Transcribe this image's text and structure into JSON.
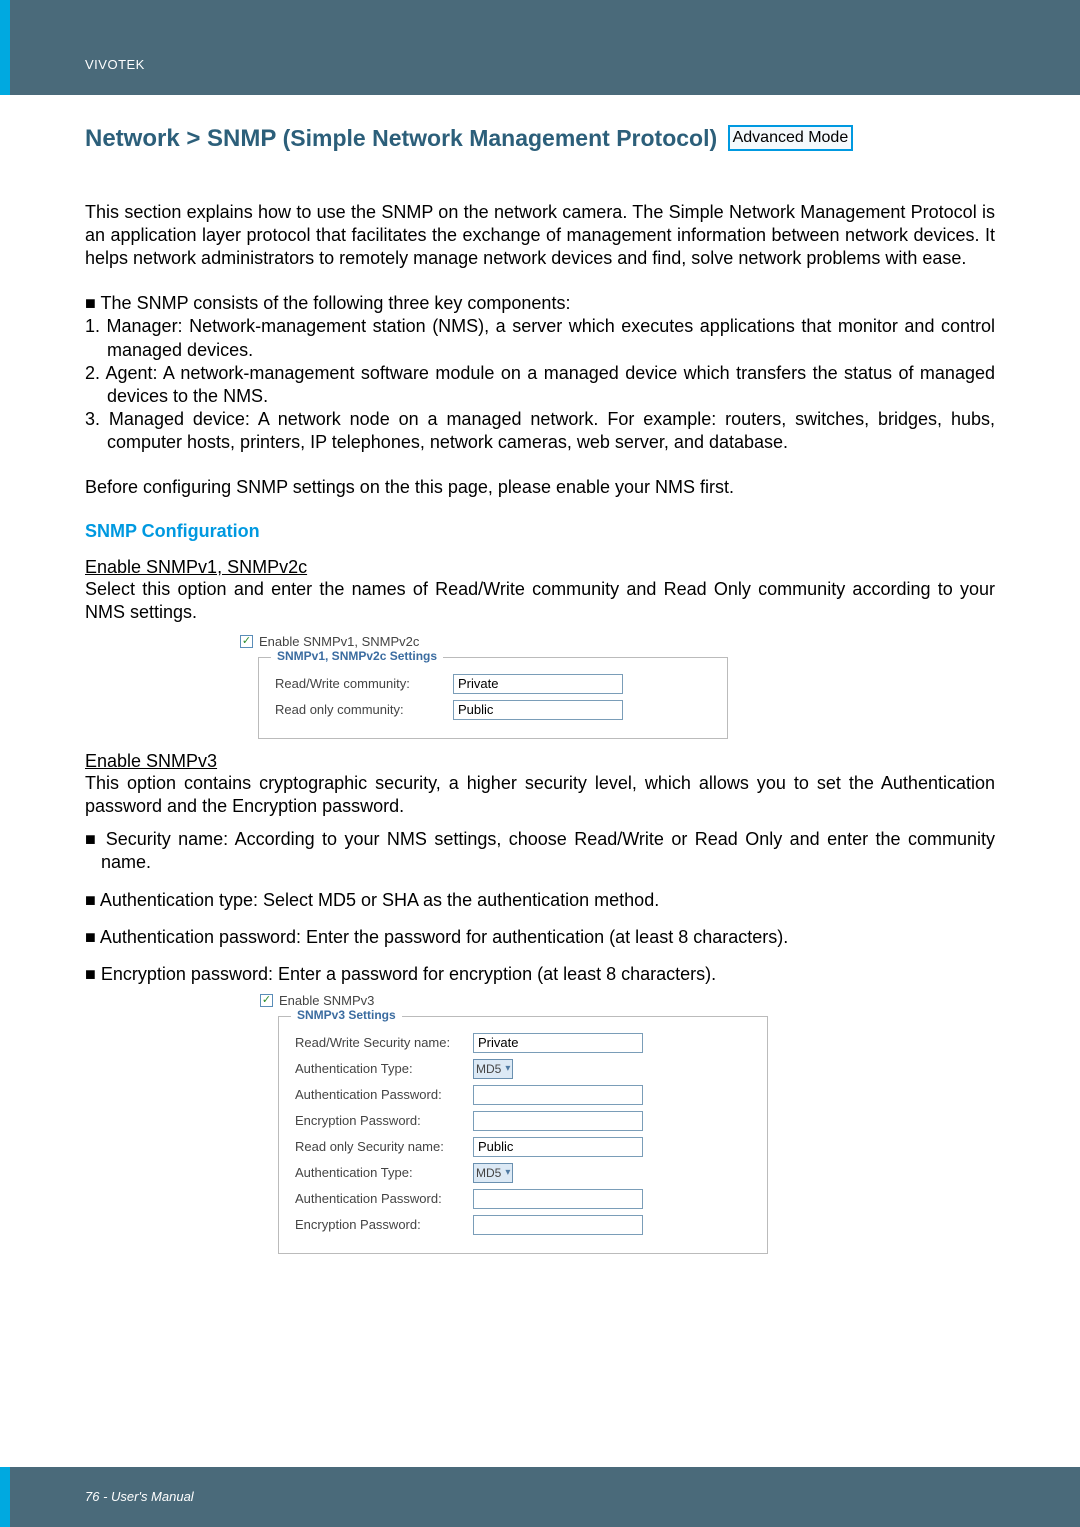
{
  "header": {
    "brand": "VIVOTEK"
  },
  "heading": {
    "main": "Network > SNMP ",
    "sub": "(Simple Network Management Protocol)",
    "badge": "Advanced Mode"
  },
  "intro": "This section explains how to use the SNMP on the network camera. The Simple Network Management Protocol is an application layer protocol that facilitates the exchange of management information between network devices. It helps network administrators to remotely manage network devices and find, solve network problems with ease.",
  "components_lead": "■ The SNMP consists of the following three key components:",
  "components": {
    "c1": "1. Manager: Network-management station (NMS), a server which executes applications that monitor and control managed devices.",
    "c2": "2. Agent: A network-management software module on a managed device which transfers the status of managed devices to the NMS.",
    "c3": "3. Managed device: A network node on a managed network. For example: routers, switches, bridges, hubs, computer hosts, printers, IP telephones, network cameras, web server, and database."
  },
  "pre_config": "Before configuring SNMP settings on the this page, please enable your NMS first.",
  "section_title": "SNMP Configuration",
  "v2c": {
    "head": "Enable SNMPv1, SNMPv2c",
    "desc": "Select this option and enter the names of Read/Write community and Read Only community according to your NMS settings.",
    "chk_label": "Enable SNMPv1, SNMPv2c",
    "legend": "SNMPv1, SNMPv2c Settings",
    "rw_label": "Read/Write community:",
    "rw_value": "Private",
    "ro_label": "Read only community:",
    "ro_value": "Public"
  },
  "v3": {
    "head": "Enable SNMPv3",
    "desc": "This option contains cryptographic security, a higher security level, which allows you to set the Authentication password and the Encryption password.",
    "b1": "■ Security name: According to your NMS settings, choose Read/Write or Read Only and enter the community name.",
    "b2": "■ Authentication type: Select MD5 or SHA as the authentication method.",
    "b3": "■ Authentication password: Enter the password for authentication (at least 8 characters).",
    "b4": "■ Encryption password: Enter a password for encryption (at least 8 characters).",
    "chk_label": "Enable SNMPv3",
    "legend": "SNMPv3 Settings",
    "rw_sec_label": "Read/Write Security name:",
    "rw_sec_value": "Private",
    "auth_type_label": "Authentication Type:",
    "auth_type_value": "MD5",
    "auth_pw_label": "Authentication Password:",
    "enc_pw_label": "Encryption Password:",
    "ro_sec_label": "Read only Security name:",
    "ro_sec_value": "Public",
    "auth_type2_value": "MD5"
  },
  "footer": {
    "page": "76 - User's Manual"
  }
}
